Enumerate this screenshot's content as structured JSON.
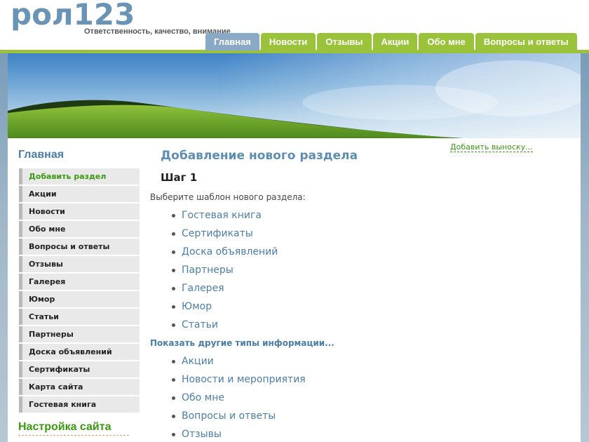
{
  "header": {
    "logo": "рол123",
    "slogan": "Ответственность, качество, внимание",
    "nav_tabs": [
      "Главная",
      "Новости",
      "Отзывы",
      "Акции",
      "Обо мне",
      "Вопросы и ответы"
    ]
  },
  "sidebar": {
    "title": "Главная",
    "items": [
      "Добавить раздел",
      "Акции",
      "Новости",
      "Обо мне",
      "Вопросы и ответы",
      "Отзывы",
      "Галерея",
      "Юмор",
      "Статьи",
      "Партнеры",
      "Доска объявлений",
      "Сертификаты",
      "Карта сайта",
      "Гостевая книга"
    ],
    "settings_title": "Настройка сайта"
  },
  "main": {
    "add_note": "Добавить выноску...",
    "title": "Добавление нового раздела",
    "step": "Шаг 1",
    "choose_text": "Выберите шаблон нового раздела:",
    "templates": [
      "Гостевая книга",
      "Сертификаты",
      "Доска объявлений",
      "Партнеры",
      "Галерея",
      "Юмор",
      "Статьи"
    ],
    "more_link": "Показать другие типы информации...",
    "other_types": [
      "Акции",
      "Новости и мероприятия",
      "Обо мне",
      "Вопросы и ответы",
      "Отзывы"
    ]
  },
  "colors": {
    "accent_green": "#9ac23a",
    "active_tab": "#8aa9c6",
    "link_blue": "#4a7ea6",
    "title_blue": "#5d8db3"
  }
}
